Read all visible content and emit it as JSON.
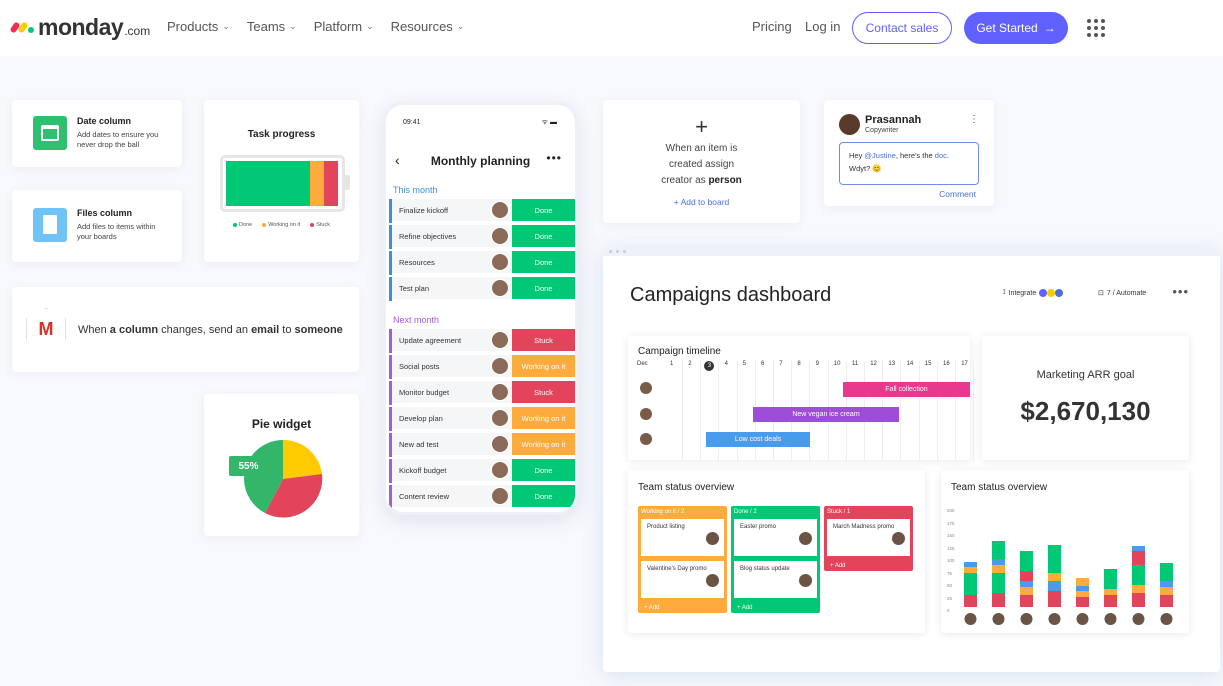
{
  "nav": {
    "brand": "monday",
    "brand_suffix": ".com",
    "menu": [
      "Products",
      "Teams",
      "Platform",
      "Resources"
    ],
    "pricing": "Pricing",
    "login": "Log in",
    "contact": "Contact sales",
    "cta": "Get Started",
    "cta_arrow": "→"
  },
  "features": {
    "date": {
      "title": "Date column",
      "desc": "Add dates to ensure you never drop the ball"
    },
    "files": {
      "title": "Files column",
      "desc": "Add files to items within your boards"
    }
  },
  "automation": {
    "letter": "M",
    "pre": "When ",
    "b1": "a column",
    "mid1": " changes, send an ",
    "b2": "email",
    "mid2": " to ",
    "b3": "someone"
  },
  "task": {
    "title": "Task progress",
    "legend": [
      "Done",
      "Working on it",
      "Stuck"
    ],
    "fractions": [
      0.74,
      0.12,
      0.12
    ]
  },
  "pie": {
    "title": "Pie widget",
    "badge": "55%"
  },
  "phone": {
    "time": "09:41",
    "status": "ᯤ ▬",
    "back": "‹",
    "title": "Monthly planning",
    "more": "•••",
    "group1": "This month",
    "group2": "Next month",
    "rows1": [
      {
        "name": "Finalize kickoff",
        "status": "Done"
      },
      {
        "name": "Refine objectives",
        "status": "Done"
      },
      {
        "name": "Resources",
        "status": "Done"
      },
      {
        "name": "Test plan",
        "status": "Done"
      }
    ],
    "rows2": [
      {
        "name": "Update agreement",
        "status": "Stuck"
      },
      {
        "name": "Social posts",
        "status": "Working on it"
      },
      {
        "name": "Monitor budget",
        "status": "Stuck"
      },
      {
        "name": "Develop plan",
        "status": "Working on it"
      },
      {
        "name": "New ad test",
        "status": "Working on it"
      },
      {
        "name": "Kickoff budget",
        "status": "Done"
      },
      {
        "name": "Content review",
        "status": "Done"
      }
    ]
  },
  "rule": {
    "plus": "+",
    "line1": "When an item is",
    "line2": "created assign",
    "line3": "creator as",
    "bold": "person",
    "add": "+ Add to board"
  },
  "comment": {
    "name": "Prasannah",
    "role": "Copywriter",
    "more": "⋮",
    "text_pre": "Hey ",
    "mention": "@Justine",
    "text_mid": ", here's the ",
    "link": "doc",
    "text_end": ".",
    "line2": "Wdyt? 😊",
    "button": "Comment"
  },
  "dashboard": {
    "title": "Campaigns dashboard",
    "integrate": "Integrate",
    "automate": "7 / Automate",
    "more": "•••",
    "timeline": {
      "title": "Campaign timeline",
      "days": [
        "Dec",
        "1",
        "2",
        "3",
        "4",
        "5",
        "6",
        "7",
        "8",
        "9",
        "10",
        "11",
        "12",
        "13",
        "14",
        "15",
        "16",
        "17"
      ],
      "bars": [
        {
          "label": "Fall collection",
          "color": "#e8398f"
        },
        {
          "label": "New vegan ice cream",
          "color": "#9e4ed6"
        },
        {
          "label": "Low cost deals",
          "color": "#4a9bec"
        }
      ]
    },
    "goal": {
      "label": "Marketing ARR goal",
      "value": "$2,670,130"
    },
    "kanban": {
      "title": "Team status overview",
      "columns": [
        {
          "header": "Working on it / 2",
          "cards": [
            "Product listing",
            "Valentine's Day promo"
          ],
          "add": "+ Add",
          "color": "#fdab3d"
        },
        {
          "header": "Done / 2",
          "cards": [
            "Easter promo",
            "Blog status update"
          ],
          "add": "+ Add",
          "color": "#00c875"
        },
        {
          "header": "Stuck / 1",
          "cards": [
            "March Madness promo"
          ],
          "add": "+ Add",
          "color": "#e2445c"
        }
      ]
    },
    "bars": {
      "title": "Team status overview",
      "ticks": [
        "200",
        "175",
        "150",
        "125",
        "100",
        "75",
        "50",
        "25",
        "0"
      ]
    }
  },
  "colors": {
    "done": "#00c875",
    "working": "#fdab3d",
    "stuck": "#e2445c",
    "accent": "#6161ff"
  }
}
